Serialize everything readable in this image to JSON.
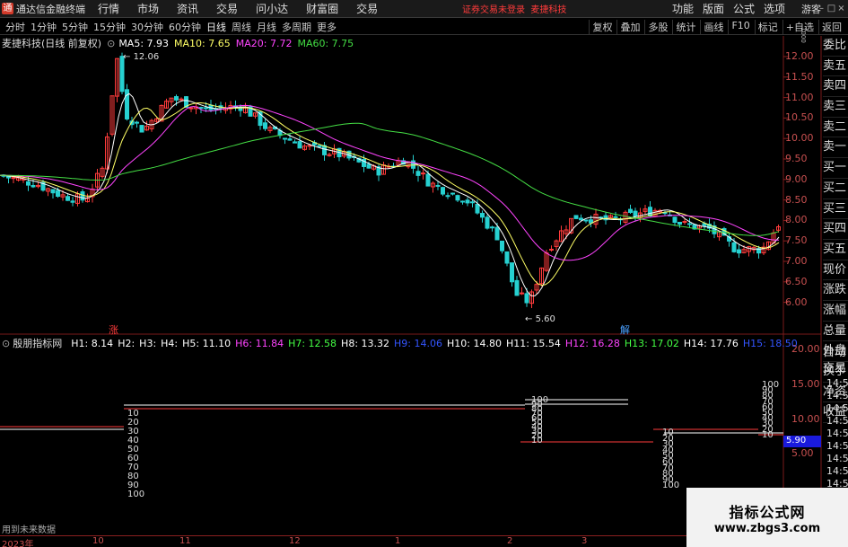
{
  "app": {
    "name": "通达信金融终端"
  },
  "menu": [
    "行情",
    "市场",
    "资讯",
    "交易",
    "问小达",
    "财富圈",
    "交易"
  ],
  "notice": "证券交易未登录",
  "stock_name_top": "麦捷科技",
  "right_menu": [
    "功能",
    "版面",
    "公式",
    "选项"
  ],
  "guest": "游客",
  "window_buttons": [
    "–",
    "□",
    "×"
  ],
  "periods": [
    "分时",
    "1分钟",
    "5分钟",
    "15分钟",
    "30分钟",
    "60分钟",
    "日线",
    "周线",
    "月线",
    "多周期",
    "更多"
  ],
  "active_period": "日线",
  "tools": [
    "复权",
    "叠加",
    "多股",
    "统计",
    "画线",
    "F10",
    "标记",
    "+自选",
    "返回"
  ],
  "info": {
    "title": "麦捷科技(日线 前复权)",
    "ma5": "MA5: 7.93",
    "ma10": "MA10: 7.65",
    "ma20": "MA20: 7.72",
    "ma60": "MA60: 7.75"
  },
  "right_column": [
    "委比",
    "卖五",
    "卖四",
    "卖三",
    "卖二",
    "卖一",
    "买一",
    "买二",
    "买三",
    "买四",
    "买五",
    "现价",
    "涨跌",
    "涨幅",
    "总量",
    "外盘",
    "换手",
    "净资",
    "收益"
  ],
  "right_column2": [
    "自动",
    "交易"
  ],
  "yaxis_main": [
    "12.00",
    "11.50",
    "11.00",
    "10.50",
    "10.00",
    "9.50",
    "9.00",
    "8.50",
    "8.00",
    "7.50",
    "7.00",
    "6.50",
    "6.00"
  ],
  "yaxis_ind": [
    "20.00",
    "15.00",
    "10.00",
    "5.00"
  ],
  "current_price": "5.90",
  "high_label": "12.06",
  "low_label": "5.60",
  "top_label": "1000",
  "marker_left": "涨",
  "marker_right": "解",
  "indicator": {
    "name": "殷朋指标网",
    "items": [
      {
        "text": "H1: 8.14",
        "color": "#ffffff"
      },
      {
        "text": "H2:",
        "color": "#ffffff"
      },
      {
        "text": "H3:",
        "color": "#ffffff"
      },
      {
        "text": "H4:",
        "color": "#ffffff"
      },
      {
        "text": "H5: 11.10",
        "color": "#ffffff"
      },
      {
        "text": "H6: 11.84",
        "color": "#ff44ff"
      },
      {
        "text": "H7: 12.58",
        "color": "#44ff44"
      },
      {
        "text": "H8: 13.32",
        "color": "#ffffff"
      },
      {
        "text": "H9: 14.06",
        "color": "#3355ff"
      },
      {
        "text": "H10: 14.80",
        "color": "#ffffff"
      },
      {
        "text": "H11: 15.54",
        "color": "#ffffff"
      },
      {
        "text": "H12: 16.28",
        "color": "#ff44ff"
      },
      {
        "text": "H13: 17.02",
        "color": "#44ff44"
      },
      {
        "text": "H14: 17.76",
        "color": "#ffffff"
      },
      {
        "text": "H15: 18.50",
        "color": "#3355ff"
      }
    ]
  },
  "ladder_left": [
    "10",
    "20",
    "30",
    "40",
    "50",
    "60",
    "70",
    "80",
    "90",
    "100"
  ],
  "ladder_mid": [
    "100",
    "90",
    "80",
    "70",
    "60",
    "50",
    "40",
    "30",
    "20",
    "10"
  ],
  "ladder_right_low": [
    "10",
    "20",
    "30",
    "40",
    "50",
    "60",
    "70",
    "80",
    "90",
    "100"
  ],
  "ladder_right_high": [
    "100",
    "90",
    "80",
    "70",
    "60",
    "50",
    "40",
    "30",
    "20",
    "10"
  ],
  "time_column": [
    "14:56",
    "14:56",
    "14:56",
    "14:56",
    "14:56",
    "14:56",
    "14:56",
    "14:56",
    "14:56"
  ],
  "footer_note": "用到未来数据",
  "xaxis": [
    {
      "label": "2023年"
    },
    {
      "label": "10"
    },
    {
      "label": "11"
    },
    {
      "label": "12"
    },
    {
      "label": "1"
    },
    {
      "label": "2"
    },
    {
      "label": "3"
    }
  ],
  "watermark": {
    "title": "指标公式网",
    "url": "www.zbgs3.com"
  },
  "colors": {
    "up": "#ff3b3b",
    "down": "#26d0d0",
    "ma5": "#ffffff",
    "ma10": "#ffff66",
    "ma20": "#ff44ff",
    "ma60": "#44dd44"
  }
}
